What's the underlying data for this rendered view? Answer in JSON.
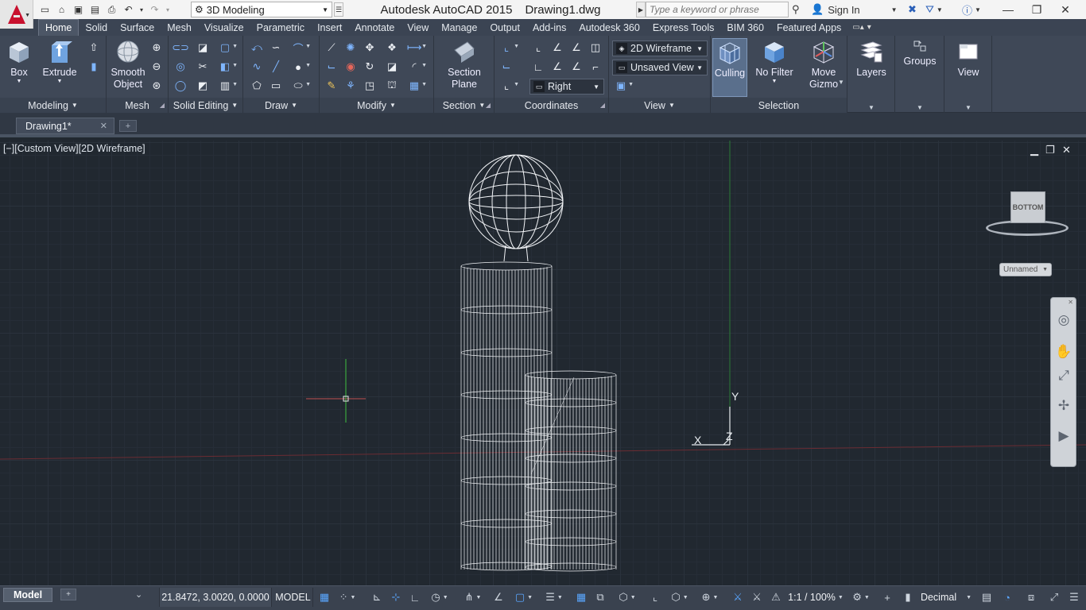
{
  "app": {
    "title": "Autodesk AutoCAD 2015",
    "document": "Drawing1.dwg",
    "workspace": "3D Modeling",
    "search_placeholder": "Type a keyword or phrase",
    "sign_in": "Sign In"
  },
  "ribbon_tabs": [
    "Home",
    "Solid",
    "Surface",
    "Mesh",
    "Visualize",
    "Parametric",
    "Insert",
    "Annotate",
    "View",
    "Manage",
    "Output",
    "Add-ins",
    "Autodesk 360",
    "Express Tools",
    "BIM 360",
    "Featured Apps"
  ],
  "active_tab": "Home",
  "panels": {
    "modeling": {
      "title": "Modeling",
      "box": "Box",
      "extrude": "Extrude"
    },
    "mesh": {
      "title": "Mesh",
      "smooth1": "Smooth",
      "smooth2": "Object"
    },
    "solid_editing": {
      "title": "Solid Editing"
    },
    "draw": {
      "title": "Draw"
    },
    "modify": {
      "title": "Modify"
    },
    "section": {
      "title": "Section",
      "plane1": "Section",
      "plane2": "Plane"
    },
    "coordinates": {
      "title": "Coordinates"
    },
    "view": {
      "title": "View",
      "visual_style": "2D Wireframe",
      "named_view": "Unsaved View",
      "view_direction": "Right"
    },
    "selection": {
      "title": "Selection",
      "culling": "Culling",
      "no_filter1": "No Filter",
      "move1": "Move",
      "move2": "Gizmo"
    },
    "layers": {
      "label": "Layers"
    },
    "groups": {
      "label": "Groups"
    },
    "viewpanel": {
      "label": "View"
    }
  },
  "file_tab": "Drawing1*",
  "viewport": {
    "label": "[−][Custom View][2D Wireframe]",
    "viewcube_face": "BOTTOM",
    "ucs_name": "Unnamed",
    "axis_x": "X",
    "axis_y": "Y",
    "axis_z": "Z"
  },
  "status": {
    "model_tab": "Model",
    "coordinates": "21.8472, 3.0020, 0.0000",
    "space": "MODEL",
    "annotation_scale": "1:1 / 100%",
    "units": "Decimal"
  },
  "colors": {
    "accent": "#5aa7ff",
    "ribbon_bg": "#3f4857",
    "canvas_bg": "#212830",
    "x_axis": "#b23a3a",
    "y_axis": "#2f9c3c",
    "logo": "#c8102e"
  }
}
